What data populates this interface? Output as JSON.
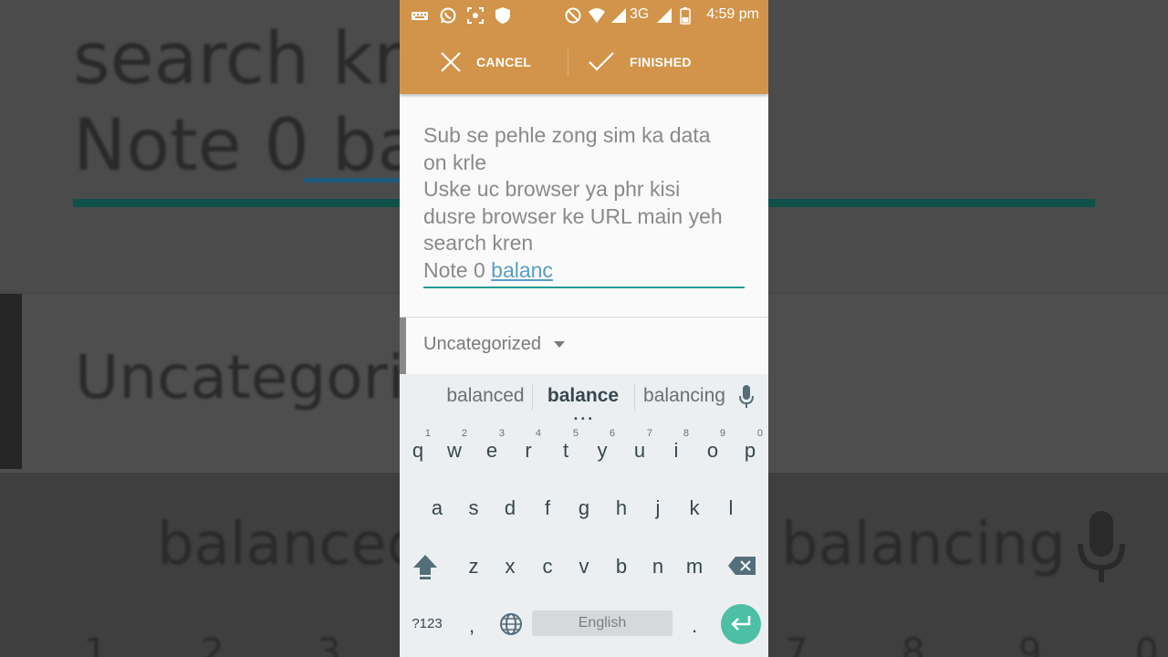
{
  "background": {
    "line1": "search kren",
    "line2_a": "Note 0 ",
    "line2_b": "bal",
    "category": "Uncategorize",
    "sugg_left": "balanced",
    "sugg_right": "balancing",
    "numbers": [
      "1",
      "2",
      "3",
      "7",
      "8",
      "9",
      "0"
    ]
  },
  "status_bar": {
    "network": "3G",
    "time": "4:59 pm"
  },
  "toolbar": {
    "cancel_label": "CANCEL",
    "finished_label": "FINISHED"
  },
  "editor": {
    "lines": [
      "Sub se pehle zong sim ka data",
      "on krle",
      "Uske uc browser ya phr kisi",
      "dusre browser ke URL main yeh",
      "search kren"
    ],
    "last_line_prefix": "Note 0 ",
    "composing_word": "balanc"
  },
  "category": {
    "selected": "Uncategorized"
  },
  "keyboard": {
    "suggestions": [
      "balanced",
      "balance",
      "balancing"
    ],
    "row1": [
      [
        "q",
        "1"
      ],
      [
        "w",
        "2"
      ],
      [
        "e",
        "3"
      ],
      [
        "r",
        "4"
      ],
      [
        "t",
        "5"
      ],
      [
        "y",
        "6"
      ],
      [
        "u",
        "7"
      ],
      [
        "i",
        "8"
      ],
      [
        "o",
        "9"
      ],
      [
        "p",
        "0"
      ]
    ],
    "row2": [
      "a",
      "s",
      "d",
      "f",
      "g",
      "h",
      "j",
      "k",
      "l"
    ],
    "row3": [
      "z",
      "x",
      "c",
      "v",
      "b",
      "n",
      "m"
    ],
    "symbols_label": "?123",
    "comma": ",",
    "space_label": "English",
    "period": "."
  },
  "colors": {
    "appbar": "#d2944a",
    "accent": "#1c9a92",
    "enter_key": "#4cbfa5"
  }
}
